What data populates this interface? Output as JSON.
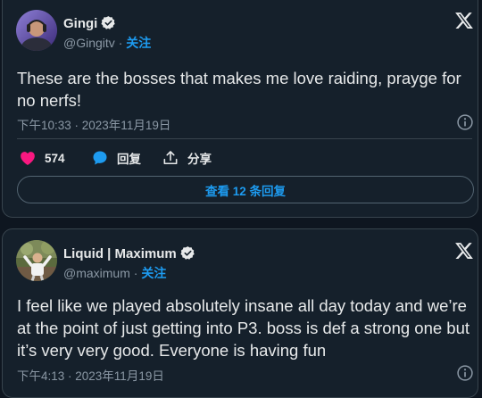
{
  "tweet1": {
    "author_name": "Gingi",
    "handle": "@Gingitv",
    "separator": "·",
    "follow_label": "关注",
    "text": "These are the bosses that makes me love raiding, prayge for no nerfs!",
    "timestamp": "下午10:33 · 2023年11月19日",
    "likes": "574",
    "reply_label": "回复",
    "share_label": "分享",
    "view_replies_label": "查看 12 条回复",
    "icons": [
      "verified-badge-icon",
      "x-logo-icon",
      "info-icon",
      "heart-icon",
      "reply-bubble-icon",
      "share-icon"
    ]
  },
  "tweet2": {
    "author_name": "Liquid | Maximum",
    "handle": "@maximum",
    "separator": "·",
    "follow_label": "关注",
    "text": "I feel like we played absolutely insane all day today and we’re at the point of just getting into P3. boss is def a strong one but it’s very very good. Everyone is having fun",
    "timestamp": "下午4:13 · 2023年11月19日",
    "icons": [
      "verified-badge-icon",
      "x-logo-icon",
      "info-icon"
    ]
  },
  "colors": {
    "background": "#15202b",
    "text_primary": "#e7e9ea",
    "text_secondary": "#8b98a5",
    "accent_blue": "#1d9bf0",
    "like_pink": "#f91880",
    "border": "#38444d"
  }
}
